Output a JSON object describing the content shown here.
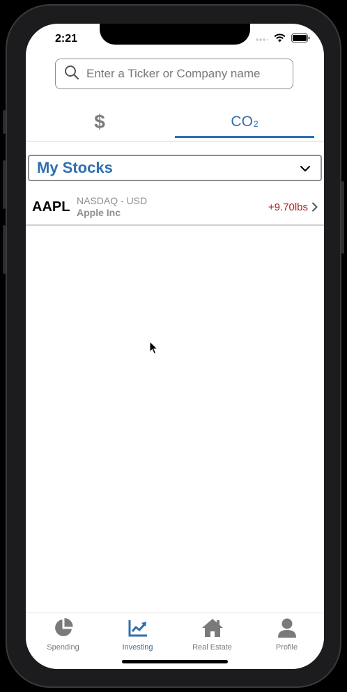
{
  "status_bar": {
    "time": "2:21"
  },
  "search": {
    "placeholder": "Enter a Ticker or Company name",
    "icon": "search-icon"
  },
  "tabs": [
    {
      "label": "$",
      "active": false
    },
    {
      "label": "CO",
      "subscript": "2",
      "active": true
    }
  ],
  "dropdown": {
    "label": "My Stocks",
    "icon": "chevron-down-icon"
  },
  "stocks": [
    {
      "ticker": "AAPL",
      "exchange": "NASDAQ - USD",
      "company": "Apple Inc",
      "change": "+9.70lbs",
      "change_color": "#b01e1e"
    }
  ],
  "tabbar": {
    "items": [
      {
        "label": "Spending",
        "icon": "pie-chart-icon",
        "active": false
      },
      {
        "label": "Investing",
        "icon": "line-chart-icon",
        "active": true
      },
      {
        "label": "Real Estate",
        "icon": "home-icon",
        "active": false
      },
      {
        "label": "Profile",
        "icon": "user-icon",
        "active": false
      }
    ]
  },
  "colors": {
    "accent": "#2f6fb1",
    "negative": "#b01e1e",
    "muted": "#8e8e93"
  }
}
